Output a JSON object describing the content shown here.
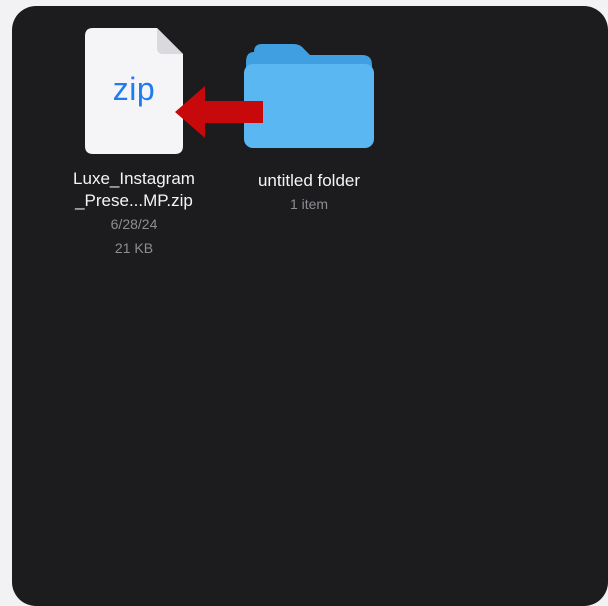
{
  "files": [
    {
      "icon": "zip-file-icon",
      "icon_text": "zip",
      "name_line1": "Luxe_Instagram",
      "name_line2": "_Prese...MP.zip",
      "date": "6/28/24",
      "size": "21 KB"
    },
    {
      "icon": "folder-icon",
      "name": "untitled folder",
      "meta": "1 item"
    }
  ],
  "annotation": {
    "icon": "red-arrow-left-icon",
    "color": "#c8090c"
  }
}
